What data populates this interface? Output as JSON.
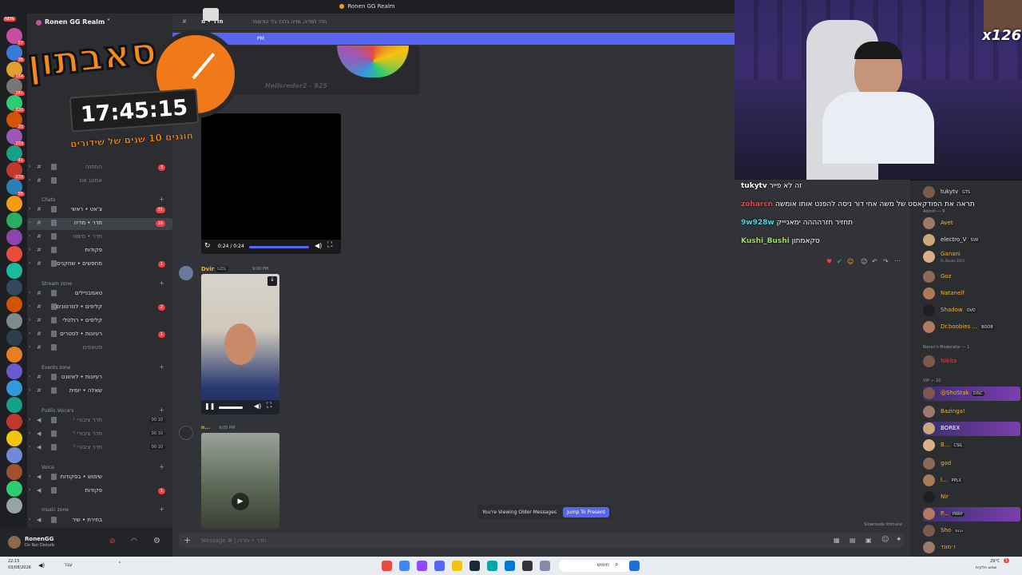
{
  "window": {
    "title": "Ronen GG Realm"
  },
  "server": {
    "name": "Ronen GG Realm"
  },
  "rail": {
    "new_label": "NEW",
    "badges": [
      "57",
      "36",
      "164",
      "181",
      "520",
      "20",
      "203",
      "41",
      "270",
      "55"
    ]
  },
  "overlay": {
    "title": "סאבתון",
    "timer": "17:45:15",
    "subtitle": "חוגגים 10 שנים של שידורים"
  },
  "webcam": {
    "multiplier": "x126"
  },
  "sidebar": {
    "top_channels": [
      {
        "name": "המתנה",
        "badge": "3"
      },
      {
        "name": "אמונג אס",
        "badge": ""
      }
    ],
    "cat_chats": "Chats",
    "chats": [
      {
        "name": "צ'אט • ראשי",
        "badge": "31"
      },
      {
        "name": "חדר • מדיה",
        "badge": "16",
        "active": true
      },
      {
        "name": "חדר • מיםס",
        "badge": ""
      },
      {
        "name": "פקודות",
        "badge": ""
      },
      {
        "name": "מחפשים • שחקנים",
        "badge": "1"
      }
    ],
    "cat_stream": "Stream zone",
    "stream": [
      {
        "name": "טאמבניילים",
        "badge": ""
      },
      {
        "name": "קליפים • לסרטונים",
        "badge": "2"
      },
      {
        "name": "קליפים • רולטלי",
        "badge": ""
      },
      {
        "name": "רעיונות • לסטרים",
        "badge": "1"
      },
      {
        "name": "סטאפים",
        "badge": ""
      }
    ],
    "cat_events": "Events zone",
    "events": [
      {
        "name": "רעיונות • לאיוונט",
        "badge": ""
      },
      {
        "name": "שאלה • יומית",
        "badge": ""
      }
    ],
    "cat_public": "Public Voice's",
    "public": [
      {
        "name": "חדר ציבורי ¹",
        "count": "00 10"
      },
      {
        "name": "חדר ציבורי ²",
        "count": "00 10"
      },
      {
        "name": "חדר ציבורי ³",
        "count": "00 10"
      }
    ],
    "cat_voice": "Voice",
    "voice": [
      {
        "name": "שימוש • בפקודות",
        "badge": ""
      },
      {
        "name": "פקודות",
        "badge": "1"
      }
    ],
    "cat_music": "music zone",
    "music": [
      {
        "name": "בחירת • שיר",
        "badge": ""
      }
    ]
  },
  "user": {
    "name": "RonenGG",
    "status": "Do Not Disturb"
  },
  "chat_header": {
    "channel": "חדר • מ",
    "topic": "חדר למדיה, מדיה בלבד בלי הודעות!"
  },
  "new_messages": {
    "label": "PM"
  },
  "video1": {
    "time": "0:24 / 0:24",
    "caption": "Hellsreder2 - 925"
  },
  "msg1": {
    "author": "Dvir",
    "tag": "GZIL",
    "time": "9:00 PM"
  },
  "msg2": {
    "author": "n...",
    "time": "9:05 PM"
  },
  "older_messages": {
    "label": "You're Viewing Older Messages",
    "jump": "Jump To Present"
  },
  "composer": {
    "placeholder": "Message # | חדר • מדיה",
    "slowmode": "Slowmode Immune"
  },
  "twitch_chat": [
    {
      "user": "tukytv",
      "color": "#ffffff",
      "text": "זה לא פייר"
    },
    {
      "user": "zoharcn",
      "color": "#ff3b3b",
      "text": "תראה את הפודקאסט של משה אחי דור ניסה להפנט אותו אומשה"
    },
    {
      "user": "9w928w",
      "color": "#4fd3e0",
      "text": "תחזיר חזרהההה ימאניייק"
    },
    {
      "user": "Kushi_Bushi",
      "color": "#9be05a",
      "text": "סקאמתון"
    }
  ],
  "members": {
    "admin_label": "Admin — 9",
    "top": [
      {
        "name": "tukytv",
        "tag": "GTS",
        "color": "#dbdee1"
      },
      {
        "name": "Avet",
        "tag": "",
        "color": "#f0b232"
      },
      {
        "name": "electro_V",
        "tag": "SVR",
        "color": "#dbdee1"
      },
      {
        "name": "Ganani",
        "tag": "",
        "sub": "FL Studio 2025",
        "color": "#f0b232"
      },
      {
        "name": "Goz",
        "tag": "",
        "color": "#f0b232"
      },
      {
        "name": "Natanelf",
        "tag": "",
        "color": "#f0b232"
      },
      {
        "name": "Shadow",
        "tag": "OVO",
        "color": "#f0b232"
      },
      {
        "name": "Dr.boobies ...",
        "tag": "BOOB",
        "color": "#f0b232"
      }
    ],
    "mod_label": "Ronen's Moderator — 1",
    "mods": [
      {
        "name": "Nikita",
        "color": "#f23f42"
      }
    ],
    "vip_label": "VIP — 10",
    "vips": [
      {
        "name": "@ShoStak",
        "tag": "DISC",
        "color": "#f0b232",
        "hl": true
      },
      {
        "name": "Bazinga!",
        "tag": "",
        "color": "#f0b232"
      },
      {
        "name": "BOREX",
        "tag": "",
        "color": "#ffffff",
        "hl": true
      },
      {
        "name": "B...",
        "tag": "CSIL",
        "color": "#f0b232"
      },
      {
        "name": "god",
        "tag": "",
        "color": "#f0b232"
      },
      {
        "name": "l...",
        "tag": "PPLX",
        "color": "#f0b232"
      },
      {
        "name": "Nir",
        "tag": "",
        "color": "#f0b232"
      },
      {
        "name": "P...",
        "tag": "PRRP",
        "color": "#f0b232",
        "hl": true
      },
      {
        "name": "Sho",
        "tag": "נכנס",
        "color": "#f0b232"
      },
      {
        "name": "ז׳מונד",
        "tag": "",
        "color": "#f0b232"
      }
    ]
  },
  "taskbar": {
    "time": "22:15",
    "date": "03/08/2026",
    "lang": "עבר",
    "search": "חיפוש",
    "weather": "29°C",
    "weather_sub": "שמש חלקית",
    "badge": "1"
  },
  "colors": {
    "accent": "#5865f2",
    "danger": "#f23f42",
    "bg": "#313338",
    "sidebar": "#2b2d31"
  }
}
